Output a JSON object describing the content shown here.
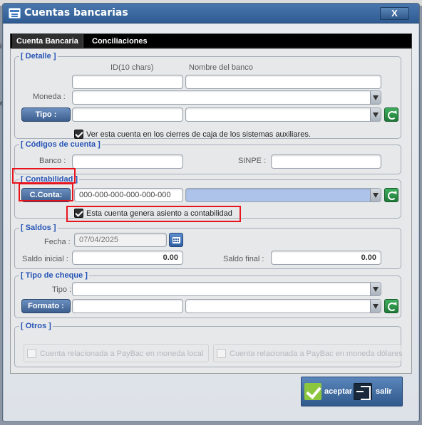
{
  "window": {
    "title": "Cuentas bancarias",
    "close_label": "X"
  },
  "tabs": [
    {
      "label": "Cuenta Bancaria",
      "active": true
    },
    {
      "label": "Conciliaciones",
      "active": false
    }
  ],
  "detalle": {
    "legend": "[ Detalle ]",
    "id_label": "ID(10 chars)",
    "id_value": "",
    "nombre_label": "Nombre del banco",
    "nombre_value": "",
    "moneda_label": "Moneda :",
    "moneda_value": "",
    "tipo_button": "Tipo :",
    "tipo_value": "",
    "tipo_select": "",
    "ver_cuenta_label": "Ver esta cuenta en los cierres de caja de los sistemas auxiliares.",
    "ver_cuenta_checked": true
  },
  "codigos": {
    "legend": "[ Códigos de cuenta ]",
    "banco_label": "Banco :",
    "banco_value": "",
    "sinpe_label": "SINPE :",
    "sinpe_value": ""
  },
  "contabilidad": {
    "legend": "[ Contabilidad ]",
    "cconta_button": "C.Conta:",
    "cconta_value": "000-000-000-000-000-000",
    "cconta_select": "",
    "asiento_label": "Esta cuenta genera asiento a contabilidad",
    "asiento_checked": true
  },
  "saldos": {
    "legend": "[ Saldos ]",
    "fecha_label": "Fecha :",
    "fecha_value": "07/04/2025",
    "saldo_inicial_label": "Saldo inicial :",
    "saldo_inicial_value": "0.00",
    "saldo_final_label": "Saldo final :",
    "saldo_final_value": "0.00"
  },
  "tipo_cheque": {
    "legend": "[ Tipo de cheque ]",
    "tipo_label": "Tipo :",
    "tipo_value": "",
    "formato_button": "Formato :",
    "formato_value": "",
    "formato_select": ""
  },
  "otros": {
    "legend": "[ Otros ]",
    "paybac_local": "Cuenta relacionada a PayBac en moneda local",
    "paybac_dolares": "Cuenta relacionada a PayBac en moneda dólares"
  },
  "footer": {
    "accept_label": "aceptar",
    "exit_label": "salir"
  },
  "colors": {
    "accent": "#2754b5",
    "titlebar": "#3a6aa3",
    "highlight": "#e8141d"
  },
  "icons": [
    "window-icon",
    "calendar-icon",
    "refresh-icon",
    "check-icon",
    "exit-icon"
  ]
}
